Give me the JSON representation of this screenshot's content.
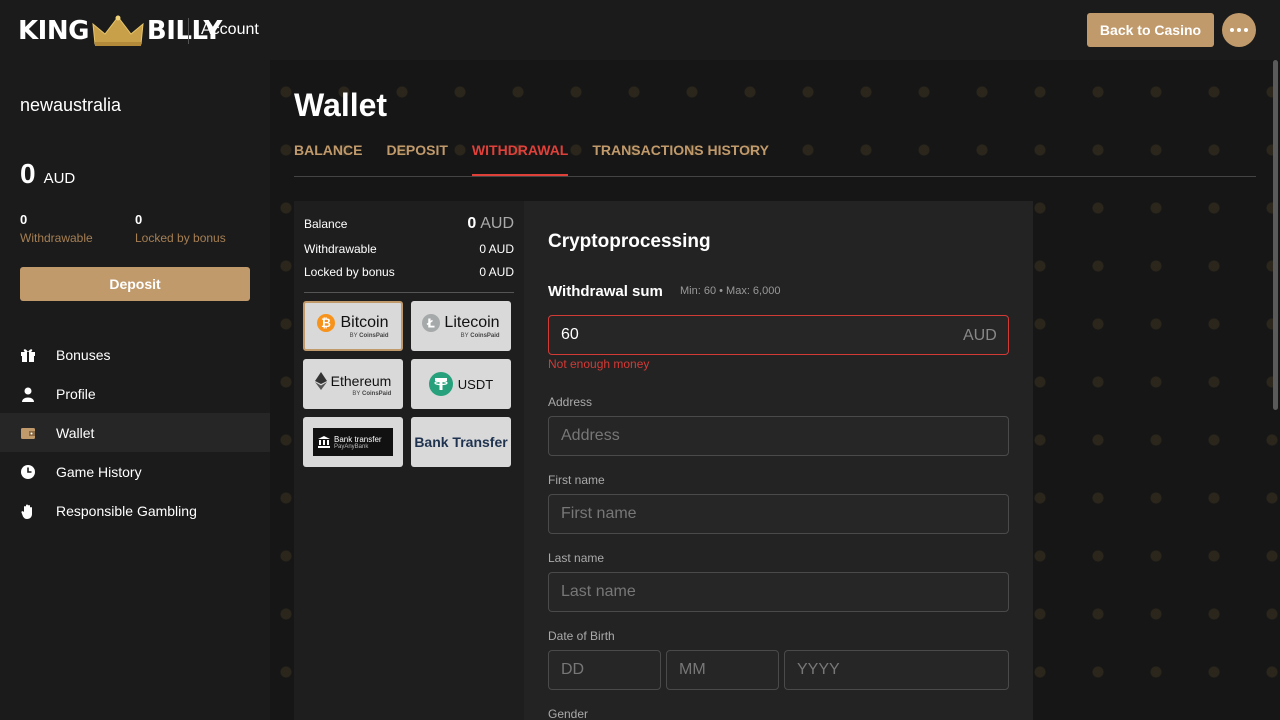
{
  "header": {
    "logo_left": "KING",
    "logo_right": "BILLY",
    "title": "Account",
    "back_button": "Back to Casino"
  },
  "sidebar": {
    "username": "newaustralia",
    "balance": "0",
    "currency": "AUD",
    "withdrawable_value": "0",
    "withdrawable_label": "Withdrawable",
    "locked_value": "0",
    "locked_label": "Locked by bonus",
    "deposit_button": "Deposit",
    "items": [
      {
        "label": "Bonuses",
        "icon": "gift-icon"
      },
      {
        "label": "Profile",
        "icon": "user-icon"
      },
      {
        "label": "Wallet",
        "icon": "wallet-icon",
        "active": true
      },
      {
        "label": "Game History",
        "icon": "clock-icon"
      },
      {
        "label": "Responsible Gambling",
        "icon": "hand-icon"
      }
    ]
  },
  "main": {
    "title": "Wallet",
    "tabs": [
      {
        "label": "BALANCE"
      },
      {
        "label": "DEPOSIT"
      },
      {
        "label": "WITHDRAWAL",
        "active": true
      },
      {
        "label": "TRANSACTIONS HISTORY"
      }
    ]
  },
  "wallet_panel": {
    "balance_label": "Balance",
    "balance_value": "0",
    "balance_currency": "AUD",
    "withdrawable_label": "Withdrawable",
    "withdrawable_value": "0 AUD",
    "locked_label": "Locked by bonus",
    "locked_value": "0 AUD",
    "methods": {
      "bitcoin": "Bitcoin",
      "litecoin": "Litecoin",
      "ethereum": "Ethereum",
      "usdt": "USDT",
      "bank_transfer_logo_title": "Bank transfer",
      "bank_transfer_logo_sub": "PayAnyBank",
      "bank_transfer": "Bank Transfer",
      "coinspaid": "CoinsPaid",
      "by": "BY"
    }
  },
  "form": {
    "title": "Cryptoprocessing",
    "sum_label": "Withdrawal sum",
    "sum_limits": "Min: 60 • Max: 6,000",
    "sum_value": "60",
    "sum_currency": "AUD",
    "error": "Not enough money",
    "address_label": "Address",
    "address_placeholder": "Address",
    "first_name_label": "First name",
    "first_name_placeholder": "First name",
    "last_name_label": "Last name",
    "last_name_placeholder": "Last name",
    "dob_label": "Date of Birth",
    "dd_placeholder": "DD",
    "mm_placeholder": "MM",
    "yyyy_placeholder": "YYYY",
    "gender_label": "Gender"
  },
  "colors": {
    "accent": "#c19a6b",
    "error": "#e0403a",
    "background": "#1b1b1b"
  }
}
